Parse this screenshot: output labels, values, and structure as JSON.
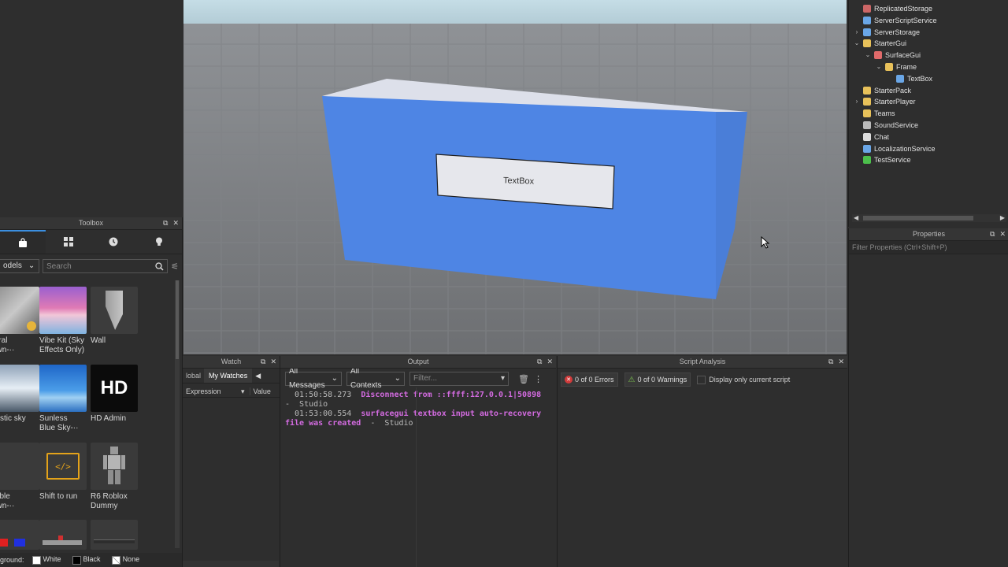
{
  "toolbox": {
    "title": "Toolbox",
    "category": "odels",
    "search_placeholder": "Search",
    "assets": [
      {
        "label": "utral\nawn-··"
      },
      {
        "label": "Vibe Kit (Sky\nEffects Only)"
      },
      {
        "label": "Wall"
      },
      {
        "label": "alistic sky"
      },
      {
        "label": "Sunless\nBlue Sky-··"
      },
      {
        "label": "HD Admin",
        "thumb_text": "HD"
      },
      {
        "label": "isible\nawn-··"
      },
      {
        "label": "Shift to run",
        "thumb_text": "</>"
      },
      {
        "label": "R6 Roblox\nDummy"
      },
      {
        "label": ""
      },
      {
        "label": ""
      },
      {
        "label": ""
      }
    ],
    "background_label": "ground:",
    "bg_white": "White",
    "bg_black": "Black",
    "bg_none": "None"
  },
  "viewport": {
    "textbox_text": "TextBox",
    "part_color": "#4e85e4"
  },
  "watch": {
    "title": "Watch",
    "tab_global": "lobal",
    "tab_my_watches": "My Watches",
    "col_expression": "Expression",
    "col_value": "Value"
  },
  "output": {
    "title": "Output",
    "filter_messages": "All Messages",
    "filter_contexts": "All Contexts",
    "filter_placeholder": "Filter...",
    "lines": [
      {
        "time": "  01:50:58.273",
        "msg": "Disconnect from ::ffff:127.0.0.1|50898"
      },
      {
        "cont": "-  Studio"
      },
      {
        "time": "  01:53:00.554",
        "msg": "surfacegui textbox input auto-recovery"
      },
      {
        "msg2": "file was created",
        "src": "  -  Studio"
      }
    ]
  },
  "script_analysis": {
    "title": "Script Analysis",
    "errors": "0 of 0 Errors",
    "warnings": "0 of 0 Warnings",
    "display_only": "Display only current script"
  },
  "explorer": {
    "items": [
      {
        "label": "ReplicatedStorage",
        "icon": "storage-icon",
        "color": "#c66",
        "depth": 0,
        "chev": ""
      },
      {
        "label": "ServerScriptService",
        "icon": "service-icon",
        "color": "#6aa6e6",
        "depth": 0,
        "chev": ""
      },
      {
        "label": "ServerStorage",
        "icon": "storage-icon",
        "color": "#6aa6e6",
        "depth": 0,
        "chev": "›"
      },
      {
        "label": "StarterGui",
        "icon": "folder-icon",
        "color": "#e8c15a",
        "depth": 0,
        "chev": "⌄"
      },
      {
        "label": "SurfaceGui",
        "icon": "surfacegui-icon",
        "color": "#e06a6a",
        "depth": 1,
        "chev": "⌄"
      },
      {
        "label": "Frame",
        "icon": "frame-icon",
        "color": "#e8c15a",
        "depth": 2,
        "chev": "⌄"
      },
      {
        "label": "TextBox",
        "icon": "textbox-icon",
        "color": "#6aa6e6",
        "depth": 3,
        "chev": ""
      },
      {
        "label": "StarterPack",
        "icon": "folder-icon",
        "color": "#e8c15a",
        "depth": 0,
        "chev": ""
      },
      {
        "label": "StarterPlayer",
        "icon": "player-icon",
        "color": "#e8c15a",
        "depth": 0,
        "chev": "›"
      },
      {
        "label": "Teams",
        "icon": "teams-icon",
        "color": "#e8c15a",
        "depth": 0,
        "chev": ""
      },
      {
        "label": "SoundService",
        "icon": "sound-icon",
        "color": "#bbbbbb",
        "depth": 0,
        "chev": ""
      },
      {
        "label": "Chat",
        "icon": "chat-icon",
        "color": "#dddddd",
        "depth": 0,
        "chev": ""
      },
      {
        "label": "LocalizationService",
        "icon": "globe-icon",
        "color": "#6aa6e6",
        "depth": 0,
        "chev": ""
      },
      {
        "label": "TestService",
        "icon": "test-icon",
        "color": "#4cbf4c",
        "depth": 0,
        "chev": ""
      }
    ]
  },
  "properties": {
    "title": "Properties",
    "filter_placeholder": "Filter Properties (Ctrl+Shift+P)"
  }
}
